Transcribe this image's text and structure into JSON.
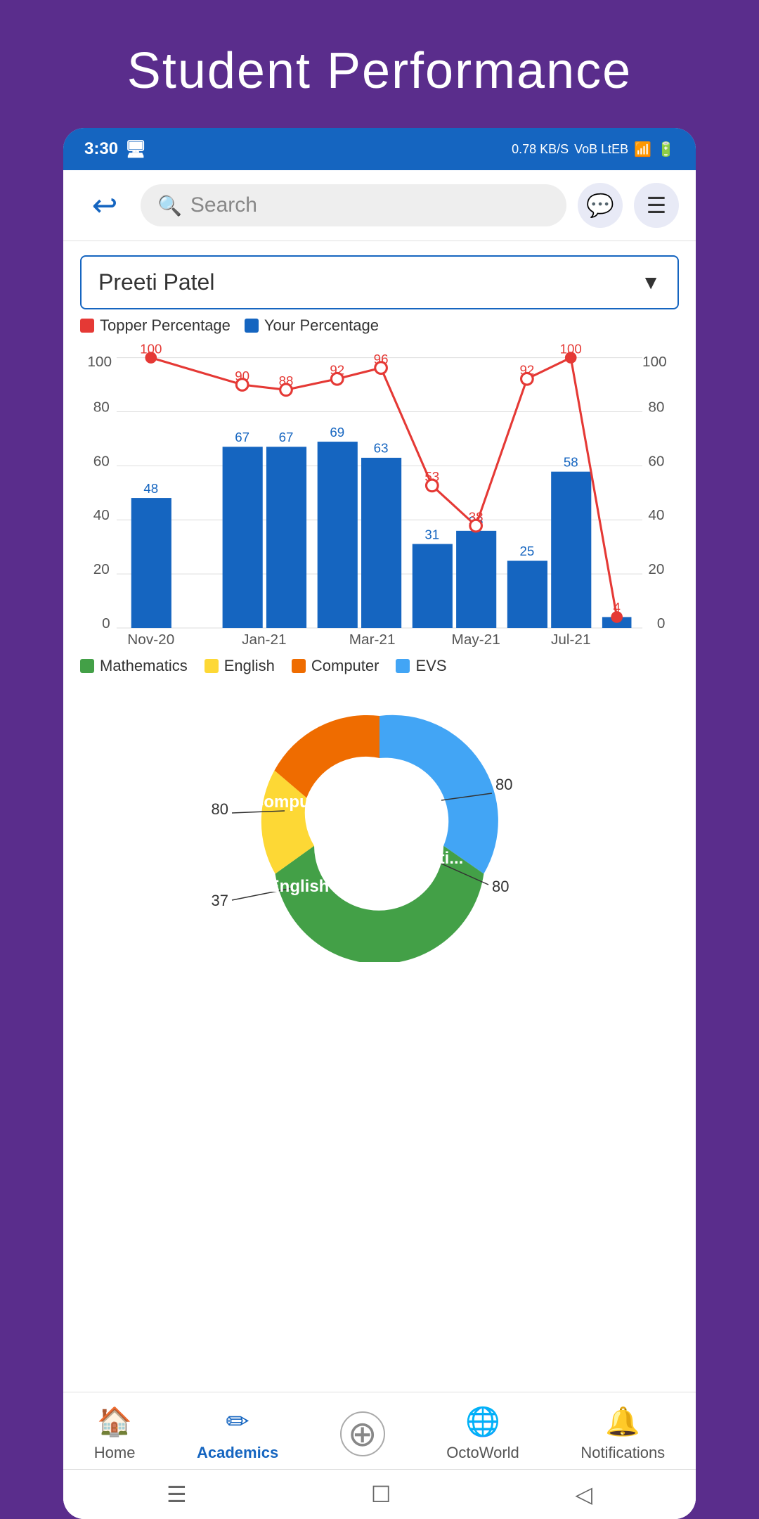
{
  "page": {
    "title": "Student Performance",
    "background_color": "#5a2d8c"
  },
  "status_bar": {
    "time": "3:30",
    "network_speed": "0.78 KB/S",
    "network_type": "4G",
    "battery": "6"
  },
  "nav_bar": {
    "search_placeholder": "Search",
    "back_button_label": "Back"
  },
  "dropdown": {
    "selected_student": "Preeti Patel"
  },
  "bar_chart": {
    "legend": {
      "topper": "Topper Percentage",
      "yours": "Your Percentage"
    },
    "months": [
      "Nov-20",
      "Jan-21",
      "Mar-21",
      "May-21",
      "Jul-21"
    ],
    "topper_line": [
      100,
      90,
      88,
      92,
      96,
      53,
      38,
      92,
      100,
      4
    ],
    "your_bars": [
      48,
      67,
      67,
      69,
      63,
      31,
      36,
      25,
      58
    ],
    "y_axis_labels": [
      0,
      20,
      40,
      60,
      80,
      100
    ],
    "subject_legend": {
      "mathematics": "Mathematics",
      "english": "English",
      "computer": "Computer",
      "evs": "EVS"
    }
  },
  "donut_chart": {
    "segments": [
      {
        "label": "EVS",
        "value": 80,
        "color": "#42a5f5"
      },
      {
        "label": "Mathematics",
        "value": 80,
        "color": "#43a047"
      },
      {
        "label": "English",
        "value": 37,
        "color": "#fdd835"
      },
      {
        "label": "Computer",
        "value": 80,
        "color": "#ef6c00"
      }
    ],
    "labels": {
      "evs_value": "80",
      "mathematics_value": "80",
      "english_value": "37",
      "computer_value": "80"
    }
  },
  "bottom_nav": {
    "items": [
      {
        "label": "Home",
        "icon": "🏠",
        "active": false
      },
      {
        "label": "Academics",
        "icon": "✏️",
        "active": true
      },
      {
        "label": "",
        "icon": "⊕",
        "active": false
      },
      {
        "label": "OctoWorld",
        "icon": "🌐",
        "active": false
      },
      {
        "label": "Notifications",
        "icon": "🔔",
        "active": false
      }
    ]
  },
  "android_nav": {
    "menu": "☰",
    "home": "☐",
    "back": "◁"
  }
}
